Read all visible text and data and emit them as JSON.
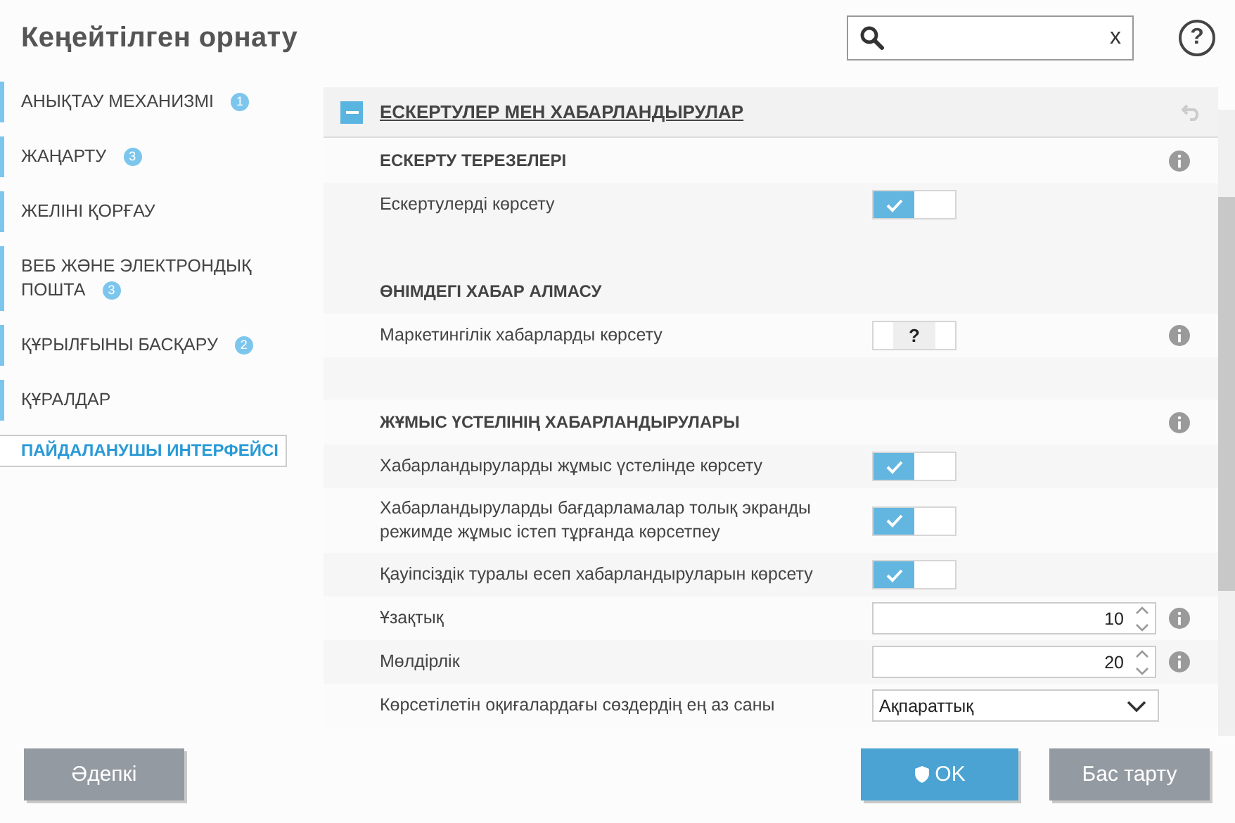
{
  "window": {
    "title": "Кеңейтілген орнату"
  },
  "search": {
    "clear": "x",
    "help": "?"
  },
  "sidebar": {
    "items": [
      {
        "label": "АНЫҚТАУ МЕХАНИЗМІ",
        "badge": "1",
        "selected": false
      },
      {
        "label": "ЖАҢАРТУ",
        "badge": "3",
        "selected": false
      },
      {
        "label": "ЖЕЛІНІ ҚОРҒАУ",
        "selected": false
      },
      {
        "label": "ВЕБ ЖӘНЕ ЭЛЕКТРОНДЫҚ ПОШТА",
        "badge": "3",
        "selected": false
      },
      {
        "label": "ҚҰРЫЛҒЫНЫ БАСҚАРУ",
        "badge": "2",
        "selected": false
      },
      {
        "label": "ҚҰРАЛДАР",
        "selected": false
      },
      {
        "label": "ПАЙДАЛАНУШЫ ИНТЕРФЕЙСІ",
        "selected": true
      }
    ]
  },
  "section": {
    "title": "ЕСКЕРТУЛЕР МЕН ХАБАРЛАНДЫРУЛАР",
    "expanded": true,
    "rows": [
      {
        "kind": "heading",
        "label": "ЕСКЕРТУ ТЕРЕЗЕЛЕРІ",
        "info": true
      },
      {
        "kind": "toggle",
        "label": "Ескертулерді көрсету",
        "checked": true,
        "info": false
      },
      {
        "kind": "spacer"
      },
      {
        "kind": "heading",
        "label": "ӨНІМДЕГІ ХАБАР АЛМАСУ",
        "info": false
      },
      {
        "kind": "toggle",
        "label": "Маркетингілік хабарларды көрсету",
        "checked": null,
        "value": "?",
        "info": true
      },
      {
        "kind": "spacer"
      },
      {
        "kind": "heading",
        "label": "ЖҰМЫС ҮСТЕЛІНІҢ ХАБАРЛАНДЫРУЛАРЫ",
        "info": true
      },
      {
        "kind": "toggle",
        "label": "Хабарландыруларды жұмыс үстелінде көрсету",
        "checked": true,
        "info": false
      },
      {
        "kind": "toggle",
        "label": "Хабарландыруларды бағдарламалар толық экранды режимде жұмыс істеп тұрғанда көрсетпеу",
        "checked": true,
        "info": false
      },
      {
        "kind": "toggle",
        "label": "Қауіпсіздік туралы есеп хабарландыруларын көрсету",
        "checked": true,
        "info": false
      },
      {
        "kind": "number",
        "label": "Ұзақтық",
        "value": "10",
        "info": true
      },
      {
        "kind": "number",
        "label": "Мөлдірлік",
        "value": "20",
        "info": true
      },
      {
        "kind": "select",
        "label": "Көрсетілетін оқиғалардағы сөздердің ең аз саны",
        "value": "Ақпараттық",
        "info": false
      }
    ]
  },
  "buttons": {
    "default": "Әдепкі",
    "ok": "OK",
    "cancel": "Бас тарту"
  }
}
